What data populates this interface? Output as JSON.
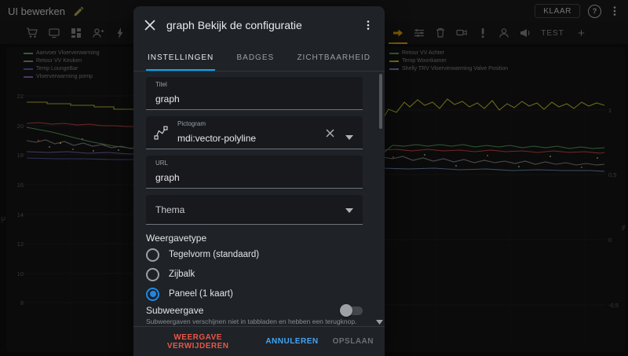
{
  "header": {
    "title": "UI bewerken",
    "done_label": "KLAAR",
    "help_glyph": "?"
  },
  "tabbar": {
    "test_label": "TEST",
    "add_label": "+"
  },
  "charts": {
    "left": {
      "y_unit": "°C",
      "y_ticks": [
        "22",
        "20",
        "18",
        "16",
        "14",
        "12",
        "10",
        "8"
      ],
      "legend": [
        {
          "label": "Aanvoer Vloerverwarming",
          "color": "#66bb6a"
        },
        {
          "label": "Retour VV Keuken",
          "color": "#9e9e9e"
        },
        {
          "label": "Temp LoungeBar",
          "color": "#5c6bc0"
        },
        {
          "label": "Vloerverwarming pomp",
          "color": "#9575cd"
        }
      ]
    },
    "right": {
      "y_unit": "%",
      "y_ticks": [
        "1",
        "0,5",
        "0",
        "-0,5"
      ],
      "legend": [
        {
          "label": "Retour VV Achter",
          "color": "#66bb6a"
        },
        {
          "label": "Temp Woonkamer",
          "color": "#dfe23a"
        },
        {
          "label": "Shelly TRV Vloerverwarming Valve Position",
          "color": "#7da6d8"
        }
      ]
    }
  },
  "dialog": {
    "title": "graph Bekijk de configuratie",
    "tabs": {
      "settings": "INSTELLINGEN",
      "badges": "BADGES",
      "visibility": "ZICHTBAARHEID"
    },
    "fields": {
      "titel": {
        "label": "Titel",
        "value": "graph"
      },
      "pictogram": {
        "label": "Pictogram",
        "value": "mdi:vector-polyline"
      },
      "url": {
        "label": "URL",
        "value": "graph"
      },
      "thema": {
        "label": "Thema"
      }
    },
    "weergavetype": {
      "label": "Weergavetype",
      "options": [
        {
          "label": "Tegelvorm (standaard)",
          "selected": false
        },
        {
          "label": "Zijbalk",
          "selected": false
        },
        {
          "label": "Paneel (1 kaart)",
          "selected": true
        }
      ]
    },
    "subweergave": {
      "label": "Subweergave",
      "enabled": false,
      "helper": "Subweergaven verschijnen niet in tabbladen en hebben een terugknop."
    },
    "footer": {
      "delete_label": "WEERGAVE VERWIJDEREN",
      "cancel_label": "ANNULEREN",
      "save_label": "OPSLAAN"
    }
  },
  "colors": {
    "accent": "#03a9f4",
    "active_view_tab": "#ffb300",
    "radio_selected": "#1e88e5",
    "delete": "#e8564a",
    "cancel": "#42a5f5"
  }
}
